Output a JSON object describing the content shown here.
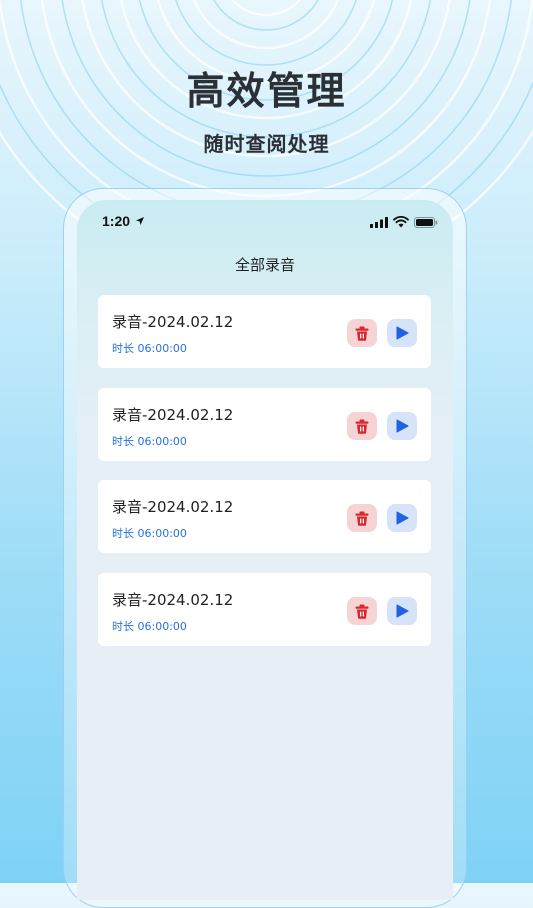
{
  "hero": {
    "headline": "高效管理",
    "subline": "随时查阅处理"
  },
  "status_bar": {
    "time": "1:20"
  },
  "screen": {
    "title": "全部录音"
  },
  "recordings": [
    {
      "title": "录音-2024.02.12",
      "duration": "时长 06:00:00"
    },
    {
      "title": "录音-2024.02.12",
      "duration": "时长 06:00:00"
    },
    {
      "title": "录音-2024.02.12",
      "duration": "时长 06:00:00"
    },
    {
      "title": "录音-2024.02.12",
      "duration": "时长 06:00:00"
    }
  ],
  "icons": {
    "delete": "trash-icon",
    "play": "play-icon"
  },
  "colors": {
    "accent_blue": "#2a6fe0",
    "delete_red": "#d8262c",
    "delete_bg": "#f6d4d6",
    "play_bg": "#d6e3f8"
  }
}
